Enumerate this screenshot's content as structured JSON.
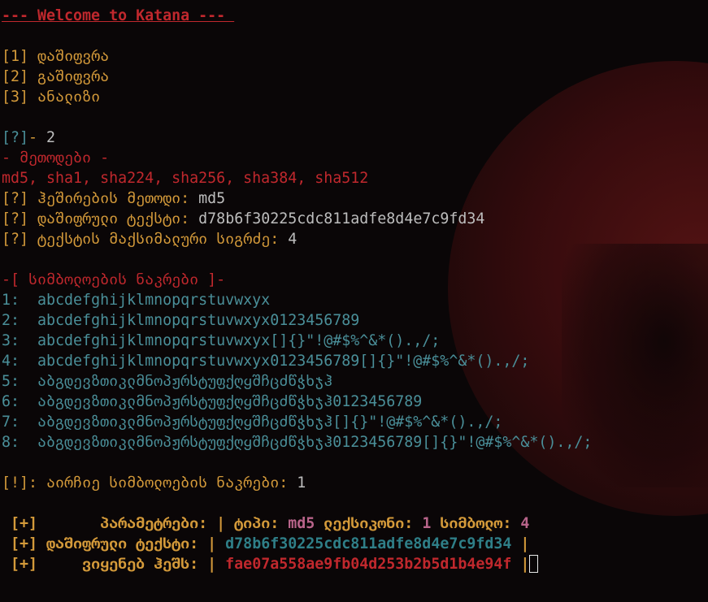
{
  "banner": "--- Welcome to Katana --- ",
  "menu": [
    {
      "index": "[1]",
      "label": "დაშიფვრა"
    },
    {
      "index": "[2]",
      "label": "გაშიფვრა"
    },
    {
      "index": "[3]",
      "label": "ანალიზი"
    }
  ],
  "prompt": {
    "marker": "[?]",
    "dash": "- ",
    "value": "2"
  },
  "methods_header": "- მეთოდები -",
  "methods_list": "md5, sha1, sha224, sha256, sha384, sha512",
  "questions": [
    {
      "marker": "[?]",
      "label": "ჰეშირების მეთოდი: ",
      "value": "md5"
    },
    {
      "marker": "[?]",
      "label": "დაშიფრული ტექსტი: ",
      "value": "d78b6f30225cdc811adfe8d4e7c9fd34"
    },
    {
      "marker": "[?]",
      "label": "ტექსტის მაქსიმალური სიგრძე: ",
      "value": "4"
    }
  ],
  "charsets_header": "-[ სიმბოლოების ნაკრები ]-",
  "charsets": [
    {
      "num": "1:  ",
      "value": "abcdefghijklmnopqrstuvwxyx"
    },
    {
      "num": "2:  ",
      "value": "abcdefghijklmnopqrstuvwxyx0123456789"
    },
    {
      "num": "3:  ",
      "value": "abcdefghijklmnopqrstuvwxyx[]{}\"!@#$%^&*().,/;"
    },
    {
      "num": "4:  ",
      "value": "abcdefghijklmnopqrstuvwxyx0123456789[]{}\"!@#$%^&*().,/;"
    },
    {
      "num": "5:  ",
      "value": "აბგდევზთიკლმნოპჟრსტუფქღყშჩცძწჭხჯჰ"
    },
    {
      "num": "6:  ",
      "value": "აბგდევზთიკლმნოპჟრსტუფქღყშჩცძწჭხჯჰ0123456789"
    },
    {
      "num": "7:  ",
      "value": "აბგდევზთიკლმნოპჟრსტუფქღყშჩცძწჭხჯჰ[]{}\"!@#$%^&*().,/;"
    },
    {
      "num": "8:  ",
      "value": "აბგდევზთიკლმნოპჟრსტუფქღყშჩცძწჭხჯჰ0123456789[]{}\"!@#$%^&*().,/;"
    }
  ],
  "choice": {
    "marker": "[!]",
    "label": ": აირჩიე სიმბოლოების ნაკრები: ",
    "value": "1"
  },
  "results": {
    "params": {
      "marker": " [+]",
      "label": "       პარამეტრები: | ",
      "type_label": "ტიპი: ",
      "type_value": "md5",
      "dict_label": " ლექსიკონი: ",
      "dict_value": "1",
      "sym_label": " სიმბოლო: ",
      "sym_value": "4"
    },
    "encrypted": {
      "marker": " [+]",
      "label": " დაშიფრული ტექსტი: | ",
      "value": "d78b6f30225cdc811adfe8d4e7c9fd34",
      "end": " |"
    },
    "hash": {
      "marker": " [+]",
      "label": "     ვიყენებ ჰეშს: | ",
      "value": "fae07a558ae9fb04d253b2b5d1b4e94f",
      "end": " |"
    }
  },
  "colors": {
    "background": "#0a0607",
    "red": "#c0282d",
    "orange": "#d49a3a",
    "teal": "#4a8f99",
    "pink": "#b8648a",
    "gray": "#bdbdbd"
  }
}
